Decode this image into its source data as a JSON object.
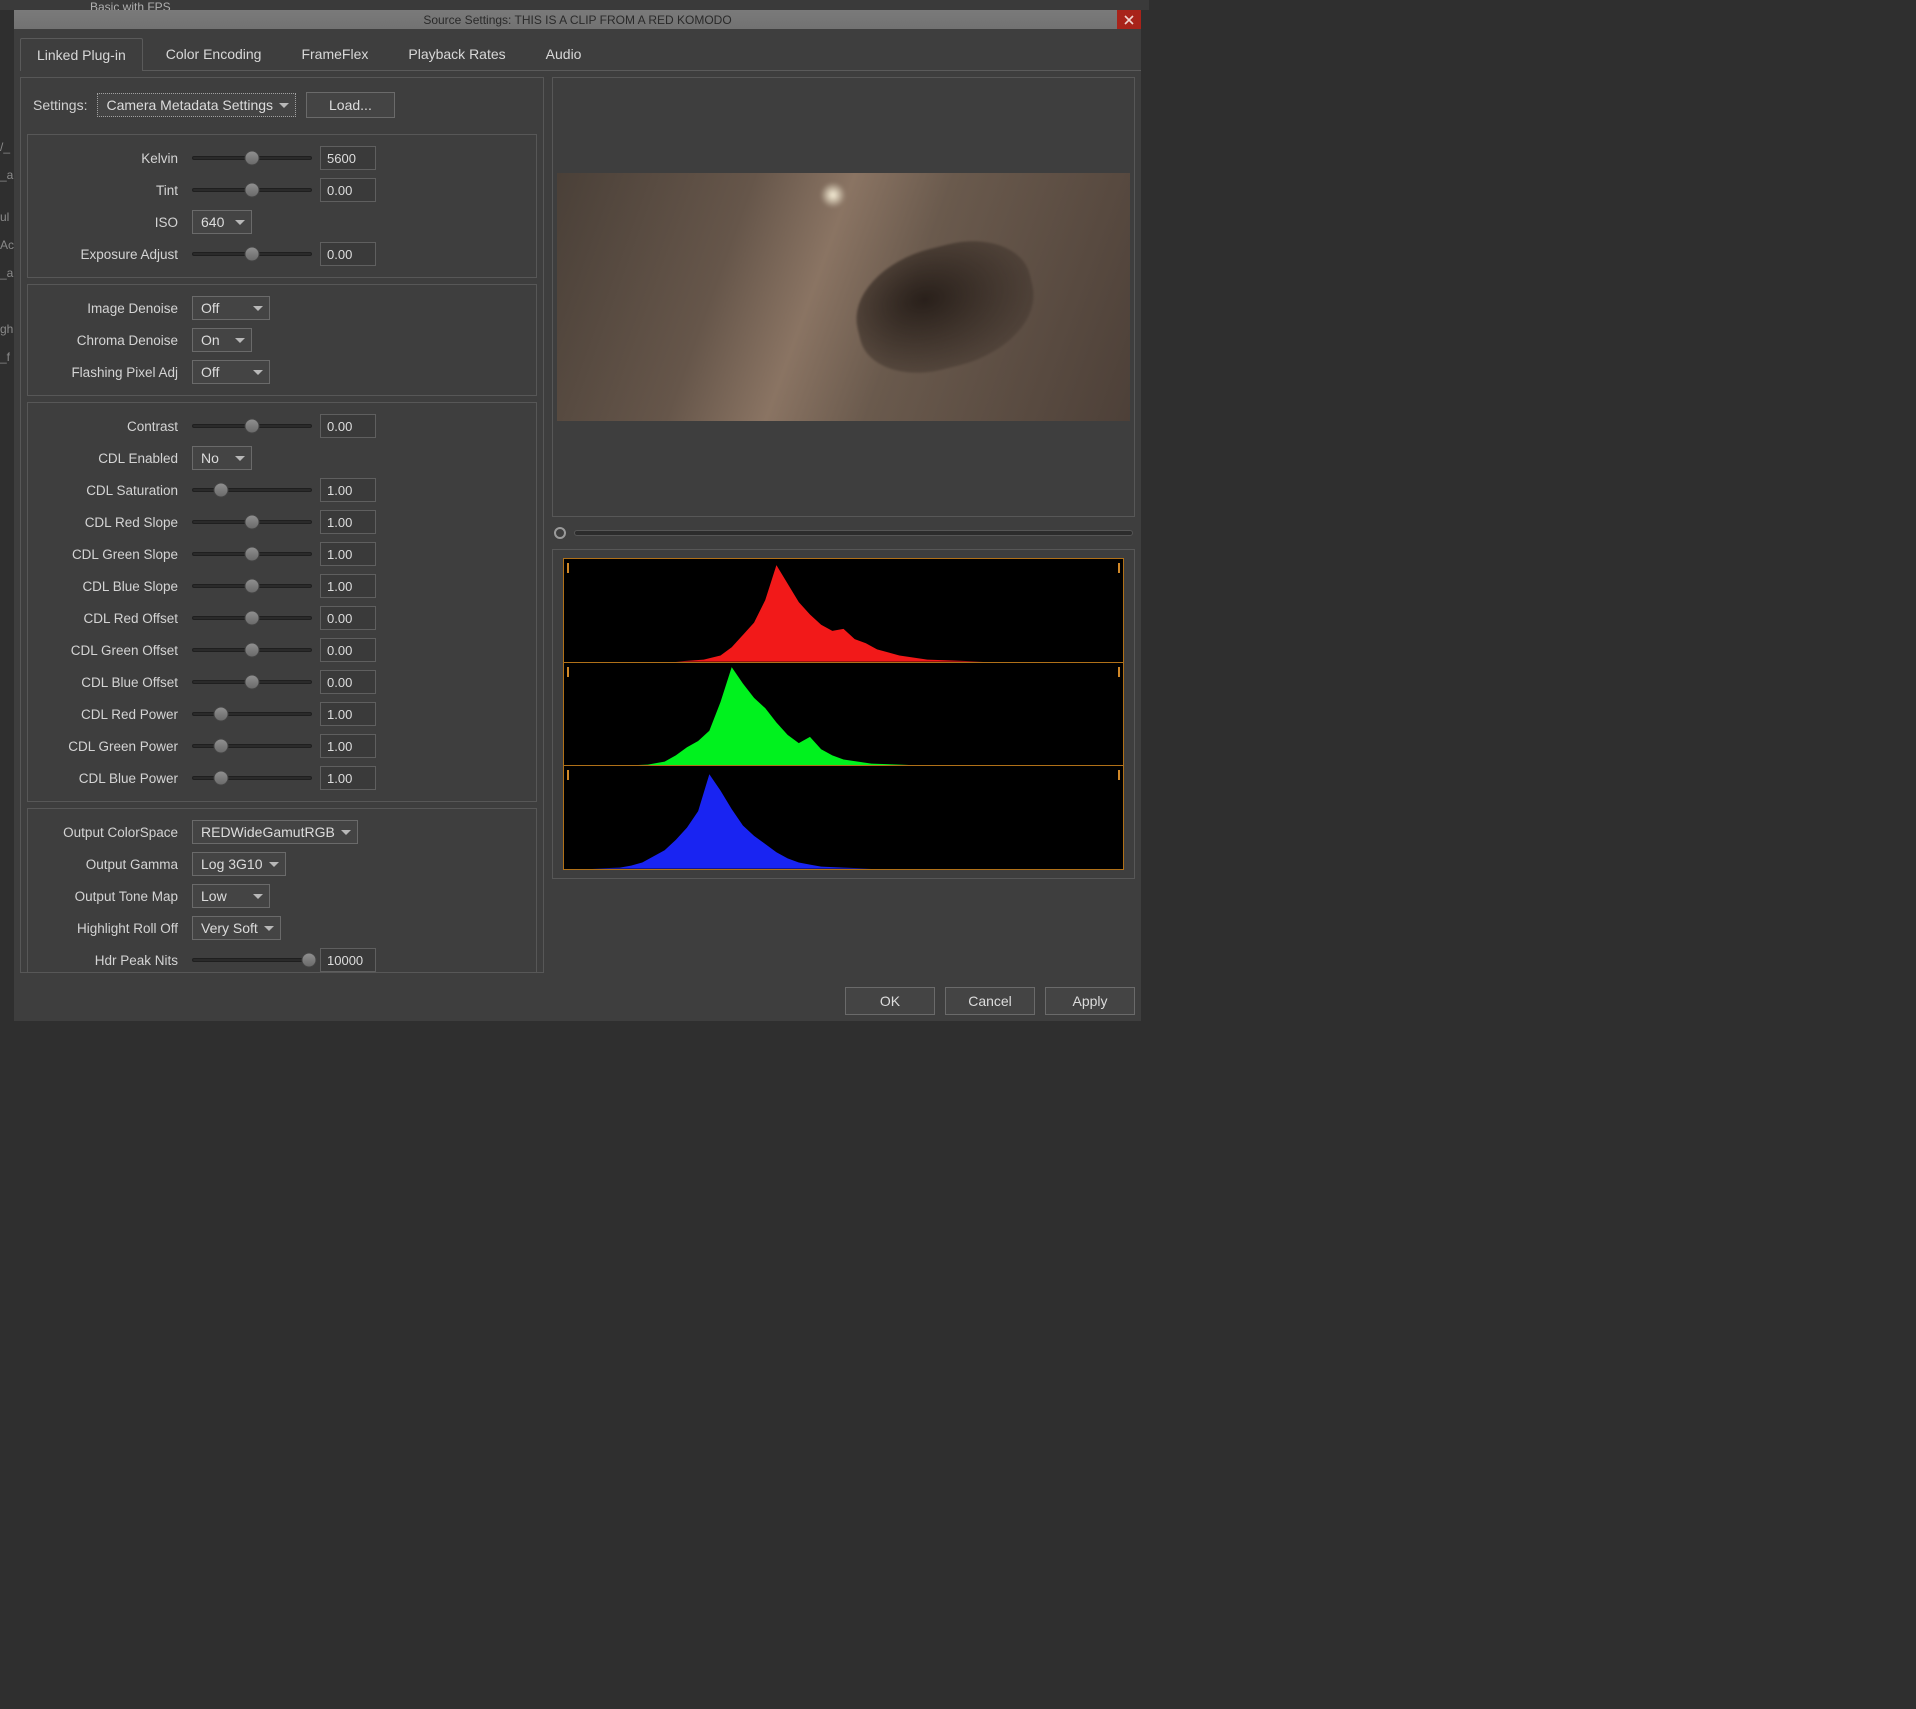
{
  "background": {
    "top_label": "Basic with FPS",
    "side_items": [
      "/_",
      "_a",
      "",
      "ul",
      "Ac",
      "_a",
      "",
      "",
      "gh",
      "_f"
    ]
  },
  "dialog": {
    "title": "Source Settings: THIS IS A CLIP FROM A RED KOMODO",
    "tabs": [
      {
        "label": "Linked Plug-in",
        "active": true
      },
      {
        "label": "Color Encoding",
        "active": false
      },
      {
        "label": "FrameFlex",
        "active": false
      },
      {
        "label": "Playback Rates",
        "active": false
      },
      {
        "label": "Audio",
        "active": false
      }
    ],
    "settings_label": "Settings:",
    "settings_dropdown": "Camera Metadata Settings",
    "load_button": "Load...",
    "groups": {
      "camera": [
        {
          "key": "kelvin",
          "label": "Kelvin",
          "type": "slider",
          "value": "5600",
          "pos": 50
        },
        {
          "key": "tint",
          "label": "Tint",
          "type": "slider",
          "value": "0.00",
          "pos": 50
        },
        {
          "key": "iso",
          "label": "ISO",
          "type": "dropdown",
          "value": "640"
        },
        {
          "key": "exposure_adjust",
          "label": "Exposure Adjust",
          "type": "slider",
          "value": "0.00",
          "pos": 50
        }
      ],
      "denoise": [
        {
          "key": "image_denoise",
          "label": "Image Denoise",
          "type": "dropdown",
          "value": "Off",
          "wide": true
        },
        {
          "key": "chroma_denoise",
          "label": "Chroma Denoise",
          "type": "dropdown",
          "value": "On"
        },
        {
          "key": "flashing_pixel_adj",
          "label": "Flashing Pixel Adj",
          "type": "dropdown",
          "value": "Off",
          "wide": true
        }
      ],
      "cdl": [
        {
          "key": "contrast",
          "label": "Contrast",
          "type": "slider",
          "value": "0.00",
          "pos": 50
        },
        {
          "key": "cdl_enabled",
          "label": "CDL Enabled",
          "type": "dropdown",
          "value": "No"
        },
        {
          "key": "cdl_saturation",
          "label": "CDL Saturation",
          "type": "slider",
          "value": "1.00",
          "pos": 24
        },
        {
          "key": "cdl_red_slope",
          "label": "CDL Red Slope",
          "type": "slider",
          "value": "1.00",
          "pos": 50
        },
        {
          "key": "cdl_green_slope",
          "label": "CDL Green Slope",
          "type": "slider",
          "value": "1.00",
          "pos": 50
        },
        {
          "key": "cdl_blue_slope",
          "label": "CDL Blue Slope",
          "type": "slider",
          "value": "1.00",
          "pos": 50
        },
        {
          "key": "cdl_red_offset",
          "label": "CDL Red Offset",
          "type": "slider",
          "value": "0.00",
          "pos": 50
        },
        {
          "key": "cdl_green_offset",
          "label": "CDL Green Offset",
          "type": "slider",
          "value": "0.00",
          "pos": 50
        },
        {
          "key": "cdl_blue_offset",
          "label": "CDL Blue Offset",
          "type": "slider",
          "value": "0.00",
          "pos": 50
        },
        {
          "key": "cdl_red_power",
          "label": "CDL Red Power",
          "type": "slider",
          "value": "1.00",
          "pos": 24
        },
        {
          "key": "cdl_green_power",
          "label": "CDL Green Power",
          "type": "slider",
          "value": "1.00",
          "pos": 24
        },
        {
          "key": "cdl_blue_power",
          "label": "CDL Blue Power",
          "type": "slider",
          "value": "1.00",
          "pos": 24
        }
      ],
      "output": [
        {
          "key": "output_colorspace",
          "label": "Output ColorSpace",
          "type": "dropdown",
          "value": "REDWideGamutRGB",
          "wide": true
        },
        {
          "key": "output_gamma",
          "label": "Output Gamma",
          "type": "dropdown",
          "value": "Log 3G10",
          "wide": true
        },
        {
          "key": "output_tone_map",
          "label": "Output Tone Map",
          "type": "dropdown",
          "value": "Low",
          "wide": true
        },
        {
          "key": "highlight_roll_off",
          "label": "Highlight Roll Off",
          "type": "dropdown",
          "value": "Very Soft",
          "wide": true
        },
        {
          "key": "hdr_peak_nits",
          "label": "Hdr Peak Nits",
          "type": "slider",
          "value": "10000",
          "pos": 98
        }
      ]
    },
    "footer": {
      "ok": "OK",
      "cancel": "Cancel",
      "apply": "Apply"
    }
  },
  "chart_data": [
    {
      "type": "area",
      "title": "Red channel histogram",
      "color": "#ff1a1a",
      "xlim": [
        0,
        100
      ],
      "ylim": [
        0,
        100
      ],
      "x": [
        0,
        5,
        10,
        15,
        20,
        25,
        28,
        30,
        32,
        34,
        36,
        38,
        40,
        42,
        44,
        46,
        48,
        50,
        52,
        54,
        56,
        60,
        65,
        70,
        75,
        80,
        100
      ],
      "values": [
        0,
        0,
        0,
        0,
        0,
        2,
        6,
        14,
        26,
        38,
        60,
        94,
        76,
        58,
        46,
        36,
        30,
        32,
        22,
        18,
        12,
        6,
        2,
        1,
        0,
        0,
        0
      ]
    },
    {
      "type": "area",
      "title": "Green channel histogram",
      "color": "#00ff20",
      "xlim": [
        0,
        100
      ],
      "ylim": [
        0,
        100
      ],
      "x": [
        0,
        5,
        10,
        15,
        18,
        20,
        22,
        24,
        26,
        28,
        30,
        32,
        34,
        36,
        38,
        40,
        42,
        44,
        46,
        48,
        50,
        55,
        60,
        65,
        70,
        80,
        100
      ],
      "values": [
        0,
        0,
        0,
        1,
        4,
        10,
        18,
        24,
        34,
        62,
        96,
        80,
        66,
        56,
        42,
        30,
        22,
        28,
        16,
        10,
        6,
        2,
        1,
        0,
        0,
        0,
        0
      ]
    },
    {
      "type": "area",
      "title": "Blue channel histogram",
      "color": "#1a26ff",
      "xlim": [
        0,
        100
      ],
      "ylim": [
        0,
        100
      ],
      "x": [
        0,
        5,
        10,
        12,
        14,
        16,
        18,
        20,
        22,
        24,
        26,
        28,
        30,
        32,
        34,
        36,
        38,
        40,
        42,
        44,
        46,
        50,
        55,
        60,
        70,
        80,
        100
      ],
      "values": [
        0,
        0,
        1,
        3,
        6,
        12,
        18,
        28,
        40,
        56,
        92,
        76,
        58,
        42,
        32,
        24,
        16,
        10,
        6,
        4,
        2,
        1,
        0,
        0,
        0,
        0,
        0
      ]
    }
  ]
}
